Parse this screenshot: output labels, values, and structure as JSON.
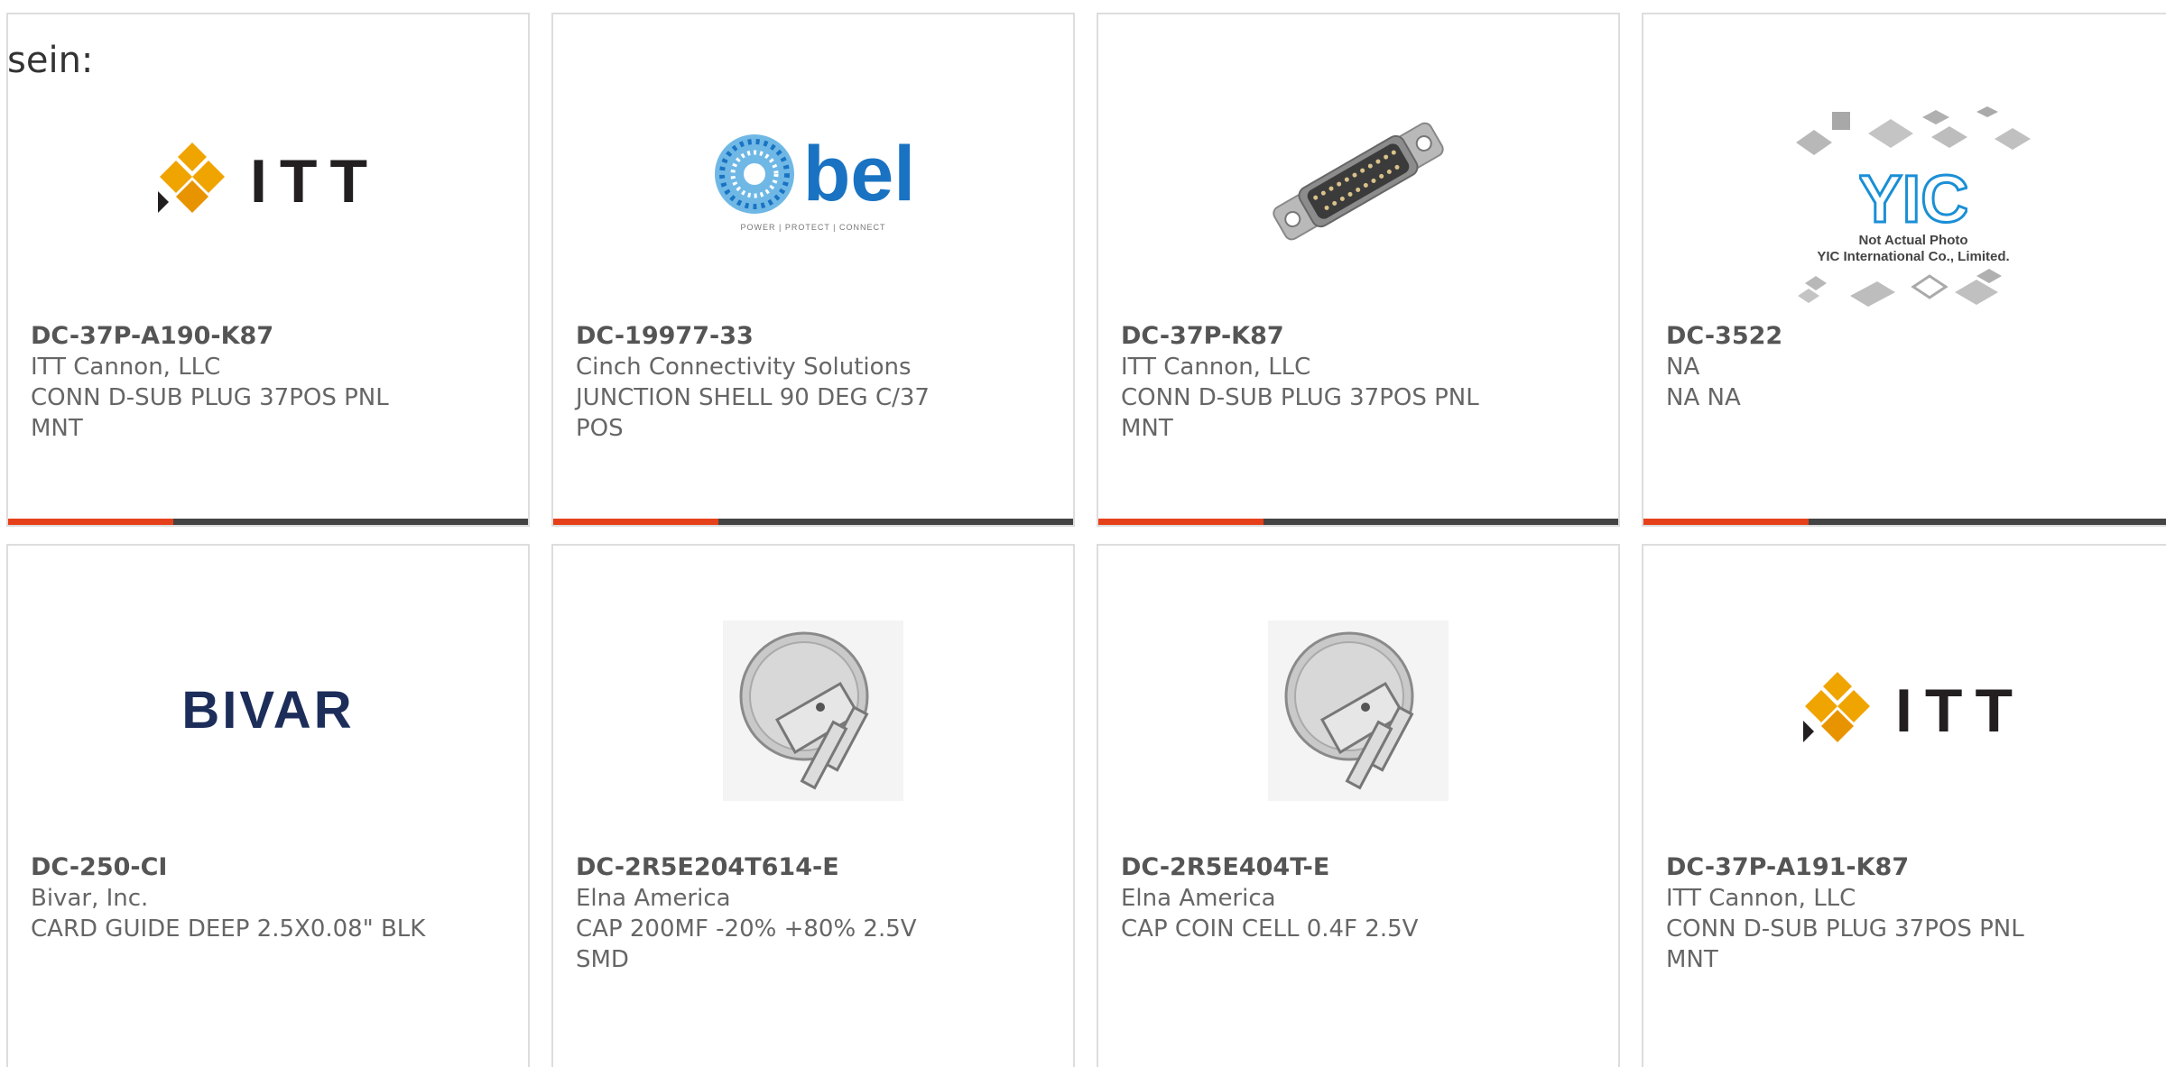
{
  "lead_text": "sein:",
  "colors": {
    "accent": "#e6401a",
    "bar": "#444444",
    "itt_gold": "#f0a400",
    "bel_blue": "#1a73c2",
    "bivar_navy": "#1c2d5a"
  },
  "products": [
    {
      "part": "DC-37P-A190-K87",
      "maker": "ITT Cannon, LLC",
      "desc1": "CONN D-SUB PLUG 37POS PNL",
      "desc2": "MNT",
      "image": "itt-logo"
    },
    {
      "part": "DC-19977-33",
      "maker": "Cinch Connectivity Solutions",
      "desc1": "JUNCTION SHELL 90 DEG C/37",
      "desc2": "POS",
      "image": "bel-logo"
    },
    {
      "part": "DC-37P-K87",
      "maker": "ITT Cannon, LLC",
      "desc1": "CONN D-SUB PLUG 37POS PNL",
      "desc2": "MNT",
      "image": "dsub-connector-photo"
    },
    {
      "part": "DC-3522",
      "maker": "NA",
      "desc1": "NA NA",
      "desc2": "",
      "image": "yic-placeholder"
    },
    {
      "part": "DC-250-CI",
      "maker": "Bivar, Inc.",
      "desc1": "CARD GUIDE DEEP 2.5X0.08\" BLK",
      "desc2": "",
      "image": "bivar-logo"
    },
    {
      "part": "DC-2R5E204T614-E",
      "maker": "Elna America",
      "desc1": "CAP 200MF -20% +80% 2.5V",
      "desc2": "SMD",
      "image": "coin-cell-photo"
    },
    {
      "part": "DC-2R5E404T-E",
      "maker": "Elna America",
      "desc1": "CAP COIN CELL 0.4F 2.5V",
      "desc2": "",
      "image": "coin-cell-photo"
    },
    {
      "part": "DC-37P-A191-K87",
      "maker": "ITT Cannon, LLC",
      "desc1": "CONN D-SUB PLUG 37POS PNL",
      "desc2": "MNT",
      "image": "itt-logo"
    }
  ],
  "logos": {
    "itt": "ITT",
    "bel": "bel",
    "bel_tagline": "POWER | PROTECT | CONNECT",
    "bivar": "BIVAR",
    "yic_mark": "YIC",
    "yic_note_1": "Not Actual Photo",
    "yic_note_2": "YIC International Co., Limited."
  }
}
